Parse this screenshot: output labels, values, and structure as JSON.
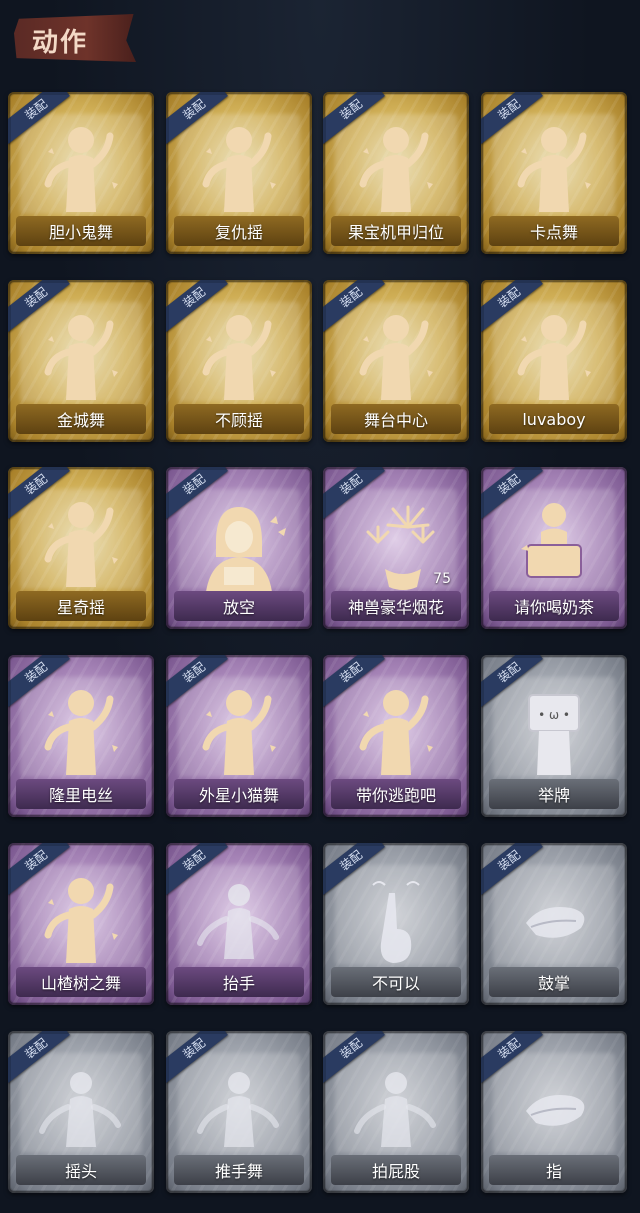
{
  "header": {
    "title": "动作"
  },
  "equip_label": "装配",
  "colors": {
    "gold": "#cfae55",
    "purple": "#a684b7",
    "gray": "#9da2ab",
    "badge": "#2a3b61",
    "header_tab": "#6e332a"
  },
  "actions": [
    {
      "label": "胆小鬼舞",
      "rarity": "gold",
      "icon": "scared-dance-icon"
    },
    {
      "label": "复仇摇",
      "rarity": "gold",
      "icon": "revenge-shake-icon"
    },
    {
      "label": "果宝机甲归位",
      "rarity": "gold",
      "icon": "mecha-pose-icon"
    },
    {
      "label": "卡点舞",
      "rarity": "gold",
      "icon": "beat-dance-icon"
    },
    {
      "label": "金城舞",
      "rarity": "gold",
      "icon": "jincheng-dance-icon"
    },
    {
      "label": "不顾摇",
      "rarity": "gold",
      "icon": "reckless-shake-icon"
    },
    {
      "label": "舞台中心",
      "rarity": "gold",
      "icon": "center-stage-icon"
    },
    {
      "label": "luvaboy",
      "rarity": "gold",
      "icon": "luvaboy-dance-icon"
    },
    {
      "label": "星奇摇",
      "rarity": "gold",
      "icon": "star-shake-icon"
    },
    {
      "label": "放空",
      "rarity": "purple",
      "icon": "hooded-reader-icon"
    },
    {
      "label": "神兽豪华烟花",
      "rarity": "purple",
      "icon": "fireworks-icon",
      "count": "75"
    },
    {
      "label": "请你喝奶茶",
      "rarity": "purple",
      "icon": "milk-tea-sign-icon"
    },
    {
      "label": "隆里电丝",
      "rarity": "purple",
      "icon": "longli-dance-icon"
    },
    {
      "label": "外星小猫舞",
      "rarity": "purple",
      "icon": "alien-cat-dance-icon"
    },
    {
      "label": "带你逃跑吧",
      "rarity": "purple",
      "icon": "run-away-icon"
    },
    {
      "label": "举牌",
      "rarity": "gray",
      "icon": "hold-sign-icon"
    },
    {
      "label": "山楂树之舞",
      "rarity": "purple",
      "icon": "hawthorn-dance-icon"
    },
    {
      "label": "抬手",
      "rarity": "purple",
      "icon": "raise-hand-icon"
    },
    {
      "label": "不可以",
      "rarity": "gray",
      "icon": "finger-wag-icon"
    },
    {
      "label": "鼓掌",
      "rarity": "gray",
      "icon": "clap-icon"
    },
    {
      "label": "摇头",
      "rarity": "gray",
      "icon": "head-shake-icon"
    },
    {
      "label": "推手舞",
      "rarity": "gray",
      "icon": "push-hand-dance-icon"
    },
    {
      "label": "拍屁股",
      "rarity": "gray",
      "icon": "butt-slap-icon"
    },
    {
      "label": "指",
      "rarity": "gray",
      "icon": "pointing-icon"
    }
  ]
}
